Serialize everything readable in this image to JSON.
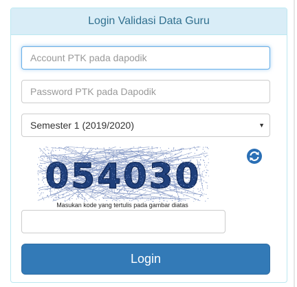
{
  "panel": {
    "title": "Login Validasi Data Guru"
  },
  "form": {
    "account_placeholder": "Account PTK pada dapodik",
    "password_placeholder": "Password PTK pada Dapodik",
    "semester_selected": "Semester 1 (2019/2020)",
    "captcha_code": "054030",
    "captcha_hint": "Masukan kode yang tertulis pada gambar diatas",
    "captcha_input_placeholder": "",
    "login_label": "Login"
  },
  "colors": {
    "heading_bg": "#d9edf7",
    "heading_text": "#31708f",
    "button_bg": "#337ab7",
    "captcha_digits": "#1f3f7a",
    "refresh_icon": "#2a6fb5"
  },
  "icons": {
    "dropdown": "caret-down-icon",
    "refresh": "refresh-icon"
  }
}
